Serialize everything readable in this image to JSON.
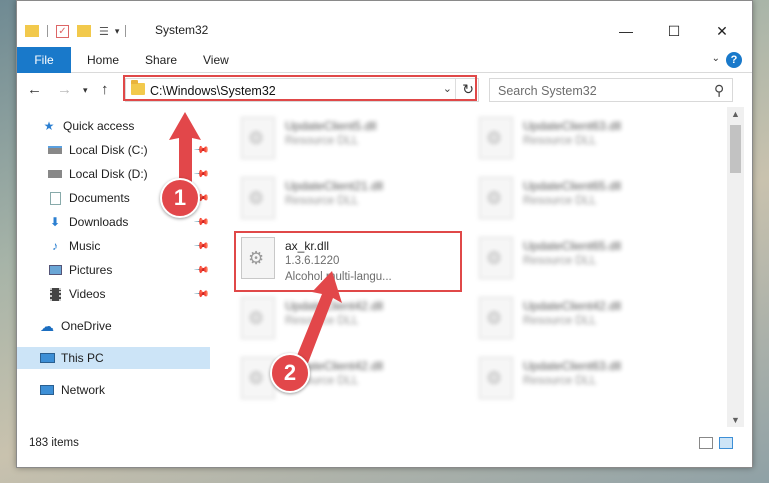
{
  "window": {
    "title": "System32",
    "minimize_glyph": "—",
    "maximize_glyph": "☐",
    "close_glyph": "✕"
  },
  "ribbon": {
    "tabs": [
      "File",
      "Home",
      "Share",
      "View"
    ],
    "help_glyph": "?"
  },
  "address_bar": {
    "path": "C:\\Windows\\System32"
  },
  "search": {
    "placeholder": "Search System32"
  },
  "sidebar": {
    "items": [
      {
        "label": "Quick access",
        "icon": "star-icon",
        "pinned": false
      },
      {
        "label": "Local Disk (C:)",
        "icon": "drive-icon",
        "pinned": true
      },
      {
        "label": "Local Disk (D:)",
        "icon": "drive-icon",
        "pinned": true
      },
      {
        "label": "Documents",
        "icon": "documents-icon",
        "pinned": true
      },
      {
        "label": "Downloads",
        "icon": "download-icon",
        "pinned": true
      },
      {
        "label": "Music",
        "icon": "music-icon",
        "pinned": true
      },
      {
        "label": "Pictures",
        "icon": "pictures-icon",
        "pinned": true
      },
      {
        "label": "Videos",
        "icon": "videos-icon",
        "pinned": true
      },
      {
        "label": "OneDrive",
        "icon": "cloud-icon",
        "pinned": false
      },
      {
        "label": "This PC",
        "icon": "computer-icon",
        "pinned": false,
        "selected": true
      },
      {
        "label": "Network",
        "icon": "network-icon",
        "pinned": false
      }
    ]
  },
  "files": [
    {
      "name": "UpdateClient5.dll",
      "sub": "Resource DLL",
      "blurred": true
    },
    {
      "name": "UpdateClient63.dll",
      "sub": "Resource DLL",
      "blurred": true
    },
    {
      "name": "UpdateClient21.dll",
      "sub": "Resource DLL",
      "blurred": true
    },
    {
      "name": "UpdateClient65.dll",
      "sub": "Resource DLL",
      "blurred": true
    },
    {
      "name": "ax_kr.dll",
      "sub": "1.3.6.1220",
      "sub2": "Alcohol multi-langu...",
      "blurred": false
    },
    {
      "name": "UpdateClient65.dll",
      "sub": "Resource DLL",
      "blurred": true
    },
    {
      "name": "UpdateClient42.dll",
      "sub": "Resource DLL",
      "blurred": true
    },
    {
      "name": "UpdateClient42.dll",
      "sub": "Resource DLL",
      "blurred": true
    },
    {
      "name": "UpdateClient42.dll",
      "sub": "Resource DLL",
      "blurred": true
    },
    {
      "name": "UpdateClient63.dll",
      "sub": "Resource DLL",
      "blurred": true
    }
  ],
  "status": {
    "item_count": "183 items"
  },
  "annotations": {
    "step1": "1",
    "step2": "2",
    "color": "#e2474a"
  }
}
